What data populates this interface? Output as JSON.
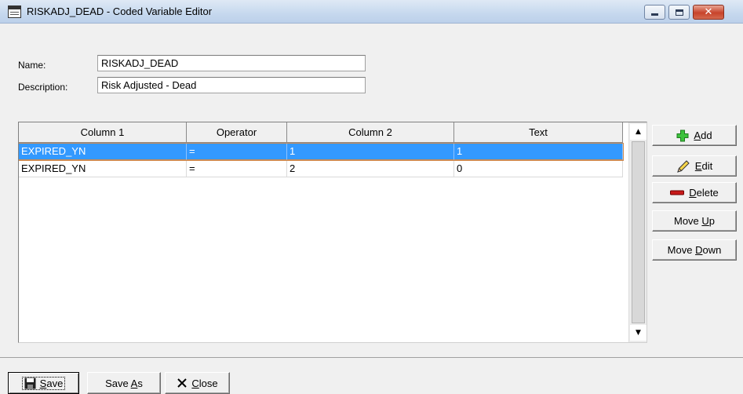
{
  "window": {
    "title": "RISKADJ_DEAD - Coded Variable Editor",
    "icon": "editor-window-icon",
    "controls": [
      "minimize-icon",
      "maximize-icon",
      "close-icon"
    ]
  },
  "form": {
    "name_label": "Name:",
    "name_value": "RISKADJ_DEAD",
    "description_label": "Description:",
    "description_value": "Risk Adjusted - Dead"
  },
  "grid": {
    "columns": [
      "Column 1",
      "Operator",
      "Column 2",
      "Text"
    ],
    "rows": [
      {
        "col1": "EXPIRED_YN",
        "op": "=",
        "col2": "1",
        "text": "1",
        "selected": true
      },
      {
        "col1": "EXPIRED_YN",
        "op": "=",
        "col2": "2",
        "text": "0",
        "selected": false
      }
    ],
    "scroll_up": "▲",
    "scroll_down": "▼"
  },
  "side_buttons": {
    "add": {
      "pre": "",
      "key": "A",
      "post": "dd",
      "icon": "green-plus-icon"
    },
    "edit": {
      "pre": "",
      "key": "E",
      "post": "dit",
      "icon": "pencil-icon"
    },
    "delete": {
      "pre": "",
      "key": "D",
      "post": "elete",
      "icon": "red-minus-icon"
    },
    "move_up": {
      "pre": "Move ",
      "key": "U",
      "post": "p"
    },
    "move_down": {
      "pre": "Move ",
      "key": "D",
      "post": "own"
    }
  },
  "bottom_buttons": {
    "save": {
      "pre": "",
      "key": "S",
      "post": "ave",
      "icon": "floppy-disk-icon"
    },
    "save_as": {
      "pre": "Save ",
      "key": "A",
      "post": "s"
    },
    "close": {
      "pre": "",
      "key": "C",
      "post": "lose",
      "icon": "x-close-icon"
    }
  },
  "colors": {
    "selection": "#3399ff",
    "selection_border": "#cc8a52",
    "window_bg": "#f0f0f0"
  }
}
